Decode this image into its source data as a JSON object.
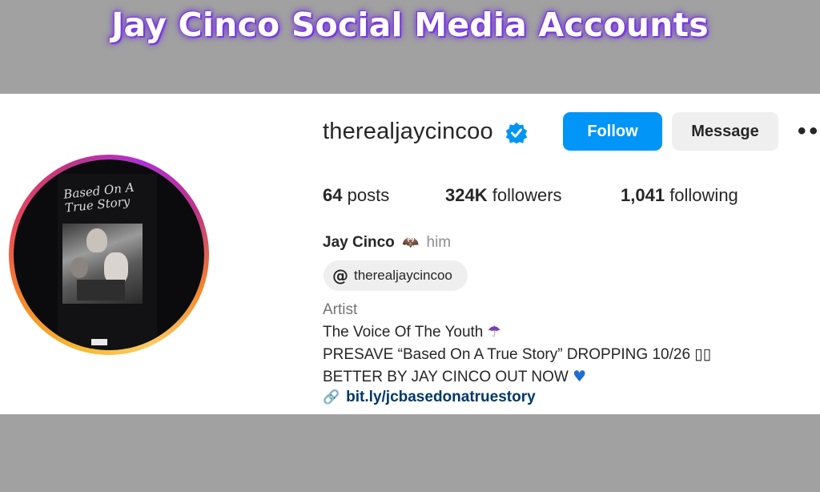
{
  "banner": {
    "title": "Jay Cinco Social Media Accounts"
  },
  "cover": {
    "title": "Based On A True Story"
  },
  "profile": {
    "username": "therealjaycincoo",
    "verified_icon": "verified-badge-icon",
    "follow_label": "Follow",
    "message_label": "Message",
    "more_icon": "more-options-icon",
    "stats": {
      "posts_count": "64",
      "posts_label": "posts",
      "followers_count": "324K",
      "followers_label": "followers",
      "following_count": "1,041",
      "following_label": "following"
    },
    "full_name": "Jay Cinco",
    "name_emoji": "🦇",
    "pronouns": "him",
    "threads_handle": "therealjaycincoo",
    "threads_icon": "threads-icon",
    "category": "Artist",
    "bio": {
      "line1": "The Voice Of The Youth",
      "line1_emoji": "☂",
      "line2": "PRESAVE “Based On A True Story” DROPPING 10/26 ▯▯",
      "line3": "BETTER BY JAY CINCO OUT NOW",
      "line3_emoji": "♥"
    },
    "link": "bit.ly/jcbasedonatruestory",
    "link_icon": "link-icon"
  },
  "colors": {
    "background": "#a1a1a1",
    "title_glow": "#7b3ce0",
    "follow_blue": "#0095f6",
    "verified_blue": "#0095f6",
    "link_color": "#00376b"
  }
}
